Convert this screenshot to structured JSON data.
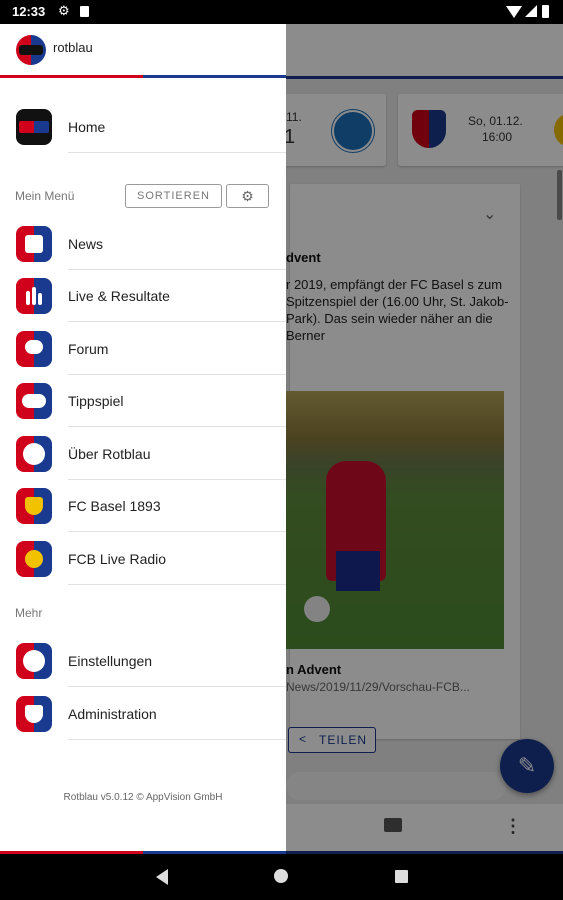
{
  "status_bar": {
    "time": "12:33"
  },
  "background": {
    "match1": {
      "date_partial": "0.11.",
      "score_partial": "1"
    },
    "match2": {
      "date": "So, 01.12.",
      "time": "16:00"
    },
    "news": {
      "title_partial": "dvent",
      "lead_partial": "r 2019, empfängt der FC Basel s zum Spitzenspiel der (16.00 Uhr, St. Jakob-Park). Das sein wieder näher an die Berner",
      "caption_title_partial": "n Advent",
      "caption_url_partial": "News/2019/11/29/Vorschau-FCB...",
      "share_label": "TEILEN"
    },
    "colors": {
      "red": "#d0021b",
      "blue": "#1a3a8f"
    }
  },
  "drawer": {
    "app_name": "rotblau",
    "home": {
      "label": "Home",
      "icon": "rotblau-logo-icon"
    },
    "my_menu": {
      "section_label": "Mein Menü",
      "sort_label": "SORTIEREN",
      "settings_icon": "gear-icon",
      "items": [
        {
          "label": "News",
          "icon": "news-icon"
        },
        {
          "label": "Live & Resultate",
          "icon": "bar-chart-icon"
        },
        {
          "label": "Forum",
          "icon": "chat-bubbles-icon"
        },
        {
          "label": "Tippspiel",
          "icon": "gamepad-icon"
        },
        {
          "label": "Über Rotblau",
          "icon": "info-icon"
        },
        {
          "label": "FC Basel 1893",
          "icon": "fcb-crest-icon"
        },
        {
          "label": "FCB Live Radio",
          "icon": "radio-icon"
        }
      ]
    },
    "more": {
      "section_label": "Mehr",
      "items": [
        {
          "label": "Einstellungen",
          "icon": "settings-gear-icon"
        },
        {
          "label": "Administration",
          "icon": "shield-icon"
        }
      ]
    },
    "version": "Rotblau v5.0.12 © AppVision GmbH"
  }
}
